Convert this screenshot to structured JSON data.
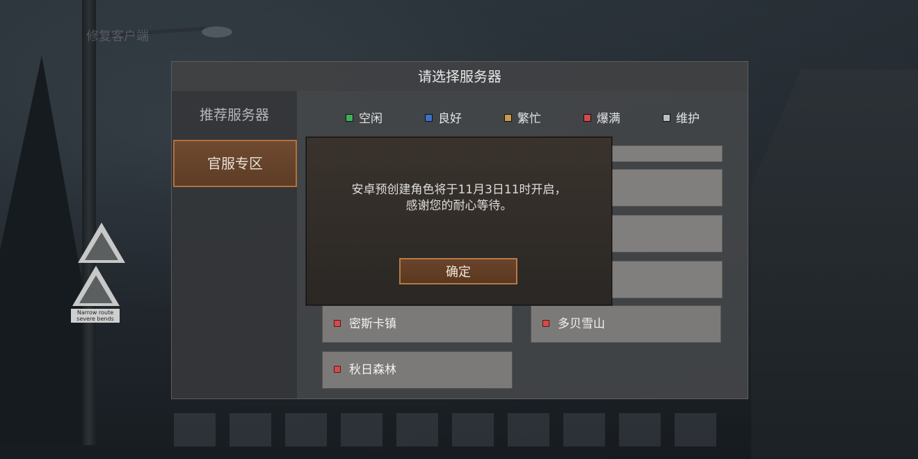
{
  "background": {
    "repair_link": "修复客户端",
    "sign_text": "Narrow route severe bends"
  },
  "dialog": {
    "title": "请选择服务器",
    "sidebar": [
      {
        "label": "推荐服务器",
        "active": false
      },
      {
        "label": "官服专区",
        "active": true
      }
    ],
    "legend": [
      {
        "label": "空闲",
        "color": "#3fb05a"
      },
      {
        "label": "良好",
        "color": "#3c72c8"
      },
      {
        "label": "繁忙",
        "color": "#c99a4a"
      },
      {
        "label": "爆满",
        "color": "#d64a4a"
      },
      {
        "label": "维护",
        "color": "#bdbdbd"
      }
    ],
    "servers": [
      {
        "name": "密斯卡镇",
        "status": "爆满"
      },
      {
        "name": "多贝雪山",
        "status": "爆满"
      },
      {
        "name": "秋日森林",
        "status": "爆满"
      }
    ]
  },
  "modal": {
    "message_line1": "安卓预创建角色将于11月3日11时开启，",
    "message_line2": "感谢您的耐心等待。",
    "confirm_label": "确定"
  }
}
